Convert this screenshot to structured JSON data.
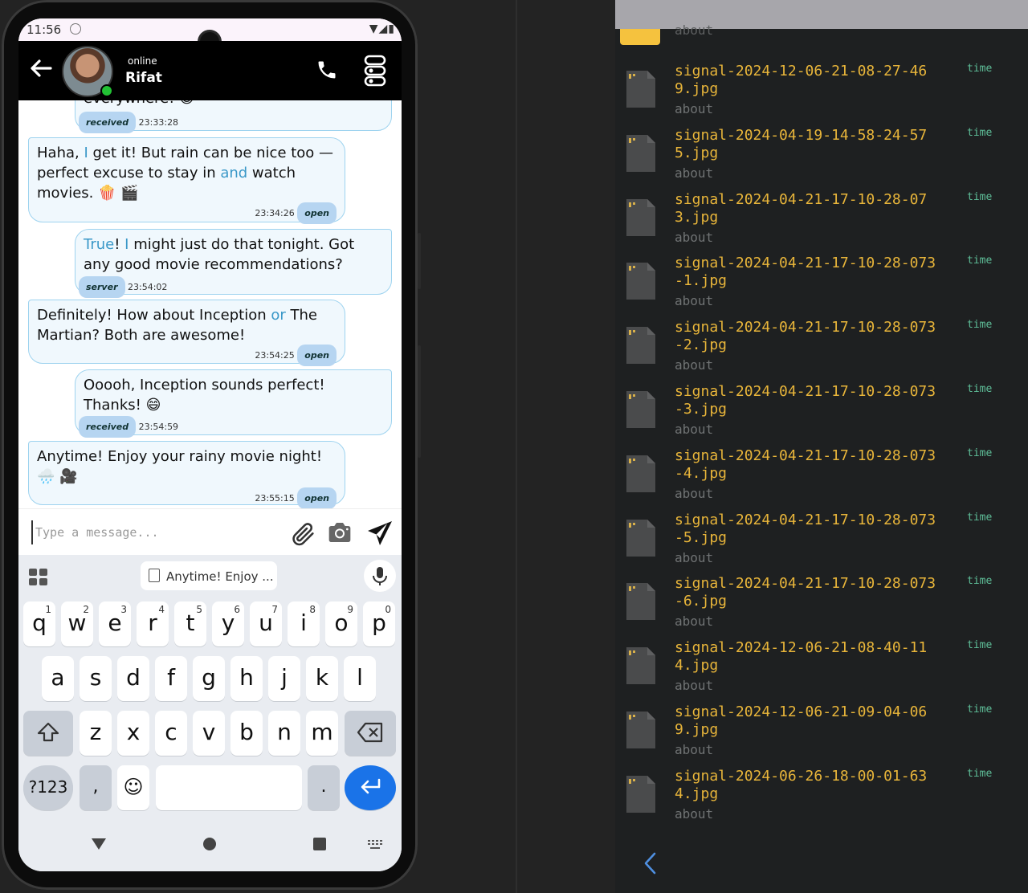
{
  "statusbar": {
    "time": "11:56"
  },
  "header": {
    "status": "online",
    "name": "Rifat"
  },
  "messages": [
    {
      "dir": "out",
      "text_partial": "everywhere! 😄",
      "status": "received",
      "time": "23:33:28"
    },
    {
      "dir": "in",
      "parts": [
        "Haha, ",
        "I",
        " get it! But rain can be nice too —perfect excuse to stay in ",
        "and",
        " watch movies. 🍿 🎬"
      ],
      "status": "open",
      "time": "23:34:26"
    },
    {
      "dir": "out",
      "parts": [
        "True",
        "! ",
        "I",
        " might just do that tonight. Got any good movie recommendations?"
      ],
      "status": "server",
      "time": "23:54:02"
    },
    {
      "dir": "in",
      "parts": [
        "Definitely! How about Inception ",
        "or",
        " The Martian? Both are awesome!"
      ],
      "status": "open",
      "time": "23:54:25"
    },
    {
      "dir": "out",
      "text": "Ooooh, Inception sounds perfect! Thanks! 😄",
      "status": "received",
      "time": "23:54:59"
    },
    {
      "dir": "in",
      "text": "Anytime! Enjoy your rainy movie night! 🌧️ 🎥",
      "status": "open",
      "time": "23:55:15"
    }
  ],
  "composer": {
    "placeholder": "Type a message..."
  },
  "keyboard": {
    "clipboard": "Anytime! Enjoy ...",
    "row1": [
      "q",
      "w",
      "e",
      "r",
      "t",
      "y",
      "u",
      "i",
      "o",
      "p"
    ],
    "row1_nums": [
      "1",
      "2",
      "3",
      "4",
      "5",
      "6",
      "7",
      "8",
      "9",
      "0"
    ],
    "row2": [
      "a",
      "s",
      "d",
      "f",
      "g",
      "h",
      "j",
      "k",
      "l"
    ],
    "row3": [
      "z",
      "x",
      "c",
      "v",
      "b",
      "n",
      "m"
    ],
    "symbols": "?123",
    "comma": ",",
    "period": "."
  },
  "files": {
    "peek_about": "about",
    "items": [
      {
        "name": "signal-2024-12-06-21-08-27-469.jpg",
        "about": "about",
        "time": "time"
      },
      {
        "name": "signal-2024-04-19-14-58-24-575.jpg",
        "about": "about",
        "time": "time"
      },
      {
        "name": "signal-2024-04-21-17-10-28-073.jpg",
        "about": "about",
        "time": "time"
      },
      {
        "name": "signal-2024-04-21-17-10-28-073-1.jpg",
        "about": "about",
        "time": "time"
      },
      {
        "name": "signal-2024-04-21-17-10-28-073-2.jpg",
        "about": "about",
        "time": "time"
      },
      {
        "name": "signal-2024-04-21-17-10-28-073-3.jpg",
        "about": "about",
        "time": "time"
      },
      {
        "name": "signal-2024-04-21-17-10-28-073-4.jpg",
        "about": "about",
        "time": "time"
      },
      {
        "name": "signal-2024-04-21-17-10-28-073-5.jpg",
        "about": "about",
        "time": "time"
      },
      {
        "name": "signal-2024-04-21-17-10-28-073-6.jpg",
        "about": "about",
        "time": "time"
      },
      {
        "name": "signal-2024-12-06-21-08-40-114.jpg",
        "about": "about",
        "time": "time"
      },
      {
        "name": "signal-2024-12-06-21-09-04-069.jpg",
        "about": "about",
        "time": "time"
      },
      {
        "name": "signal-2024-06-26-18-00-01-634.jpg",
        "about": "about",
        "time": "time"
      }
    ]
  },
  "colors": {
    "accent": "#3a98c8",
    "file_name": "#e8b53a",
    "time_label": "#5fbf99",
    "enter_key": "#1a73e8"
  }
}
